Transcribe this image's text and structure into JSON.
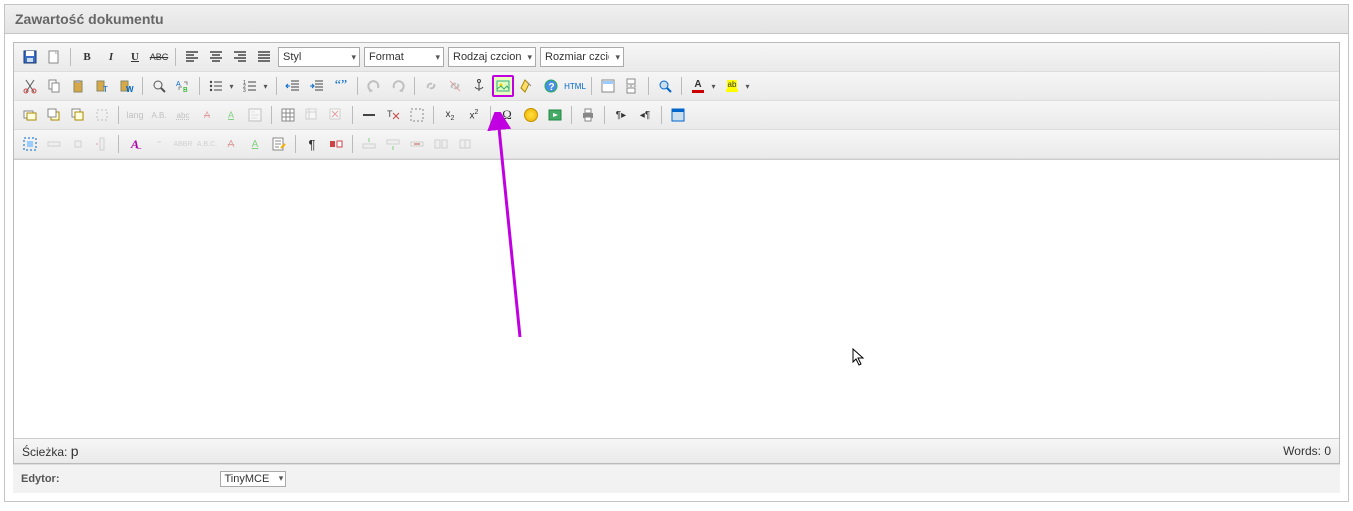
{
  "panel": {
    "title": "Zawartość dokumentu"
  },
  "toolbar": {
    "selects": {
      "style": "Styl",
      "format": "Format",
      "fontfamily": "Rodzaj czcionki",
      "fontsize": "Rozmiar czcionki"
    }
  },
  "status": {
    "path_label": "Ścieżka:",
    "path_value": "p",
    "words_label": "Words:",
    "words_count": "0"
  },
  "footer": {
    "editor_label": "Edytor:",
    "editor_value": "TinyMCE"
  }
}
